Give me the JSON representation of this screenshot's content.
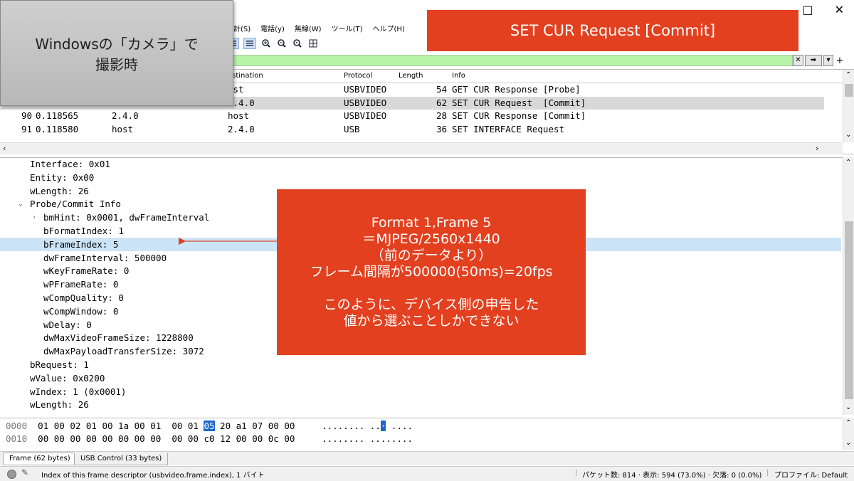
{
  "menu": [
    "統計(S)",
    "電話(y)",
    "無線(W)",
    "ツール(T)",
    "ヘルプ(H)"
  ],
  "window_controls": {
    "maximize": "□",
    "close": "✕"
  },
  "filter": {
    "clear": "✕",
    "apply": "➡",
    "dropdown": "▾",
    "add": "+"
  },
  "packet_list": {
    "columns": [
      "estination",
      "Protocol",
      "Length",
      "Info"
    ],
    "rows": [
      {
        "no": "",
        "time": "",
        "source": "",
        "destination": "ost",
        "protocol": "USBVIDEO",
        "length": "54",
        "info": "GET CUR Response [Probe]"
      },
      {
        "no": "",
        "time": "",
        "source": "",
        "destination": "2.4.0",
        "protocol": "USBVIDEO",
        "length": "62",
        "info": "SET CUR Request  [Commit]"
      },
      {
        "no": "90",
        "time": "0.118565",
        "source": "2.4.0",
        "destination": "host",
        "protocol": "USBVIDEO",
        "length": "28",
        "info": "SET CUR Response [Commit]"
      },
      {
        "no": "91",
        "time": "0.118580",
        "source": "host",
        "destination": "2.4.0",
        "protocol": "USB",
        "length": "36",
        "info": "SET INTERFACE Request"
      }
    ]
  },
  "details": [
    {
      "indent": 0,
      "toggle": "",
      "text": "Interface: 0x01"
    },
    {
      "indent": 0,
      "toggle": "",
      "text": "Entity: 0x00"
    },
    {
      "indent": 0,
      "toggle": "",
      "text": "wLength: 26"
    },
    {
      "indent": 0,
      "toggle": "⌄",
      "text": "Probe/Commit Info"
    },
    {
      "indent": 1,
      "toggle": "›",
      "text": "bmHint: 0x0001, dwFrameInterval"
    },
    {
      "indent": 1,
      "toggle": "",
      "text": "bFormatIndex: 1"
    },
    {
      "indent": 1,
      "toggle": "",
      "text": "bFrameIndex: 5"
    },
    {
      "indent": 1,
      "toggle": "",
      "text": "dwFrameInterval: 500000"
    },
    {
      "indent": 1,
      "toggle": "",
      "text": "wKeyFrameRate: 0"
    },
    {
      "indent": 1,
      "toggle": "",
      "text": "wPFrameRate: 0"
    },
    {
      "indent": 1,
      "toggle": "",
      "text": "wCompQuality: 0"
    },
    {
      "indent": 1,
      "toggle": "",
      "text": "wCompWindow: 0"
    },
    {
      "indent": 1,
      "toggle": "",
      "text": "wDelay: 0"
    },
    {
      "indent": 1,
      "toggle": "",
      "text": "dwMaxVideoFrameSize: 1228800"
    },
    {
      "indent": 1,
      "toggle": "",
      "text": "dwMaxPayloadTransferSize: 3072"
    },
    {
      "indent": 0,
      "toggle": "",
      "text": "bRequest: 1"
    },
    {
      "indent": 0,
      "toggle": "",
      "text": "wValue: 0x0200"
    },
    {
      "indent": 0,
      "toggle": "",
      "text": "wIndex: 1 (0x0001)"
    },
    {
      "indent": 0,
      "toggle": "",
      "text": "wLength: 26"
    }
  ],
  "hex": [
    {
      "offset": "0000",
      "pre": "01 00 02 01 00 1a 00 01  00 01 ",
      "hl": "05",
      "post": " 20 a1 07 00 00",
      "ascii_pre": "........ ..",
      "ascii_hl": "·",
      "ascii_post": " ...."
    },
    {
      "offset": "0010",
      "pre": "00 00 00 00 00 00 00 00  00 00 c0 12 00 00 0c 00",
      "hl": "",
      "post": "",
      "ascii_pre": "........ ........",
      "ascii_hl": "",
      "ascii_post": ""
    }
  ],
  "tabs": [
    "Frame (62 bytes)",
    "USB Control (33 bytes)"
  ],
  "status": {
    "field_desc": "Index of this frame descriptor (usbvideo.frame.index), 1 バイト",
    "packets": "パケット数: 814 · 表示: 594 (73.0%) · 欠落: 0 (0.0%)",
    "profile": "プロファイル: Default"
  },
  "overlays": {
    "gray_callout": [
      "Windowsの「カメラ」で",
      "撮影時"
    ],
    "red_title": "SET CUR Request [Commit]",
    "red_box": [
      "Format 1,Frame 5",
      "＝MJPEG/2560x1440",
      "（前のデータより）",
      "フレーム間隔が500000(50ms)=20fps",
      "",
      "このように、デバイス側の申告した",
      "値から選ぶことしかできない"
    ]
  },
  "colors": {
    "filter_ok": "#b8f5a9",
    "selection": "#cce4f7",
    "callout_red": "#e2401f",
    "hex_highlight": "#1a66cc"
  }
}
